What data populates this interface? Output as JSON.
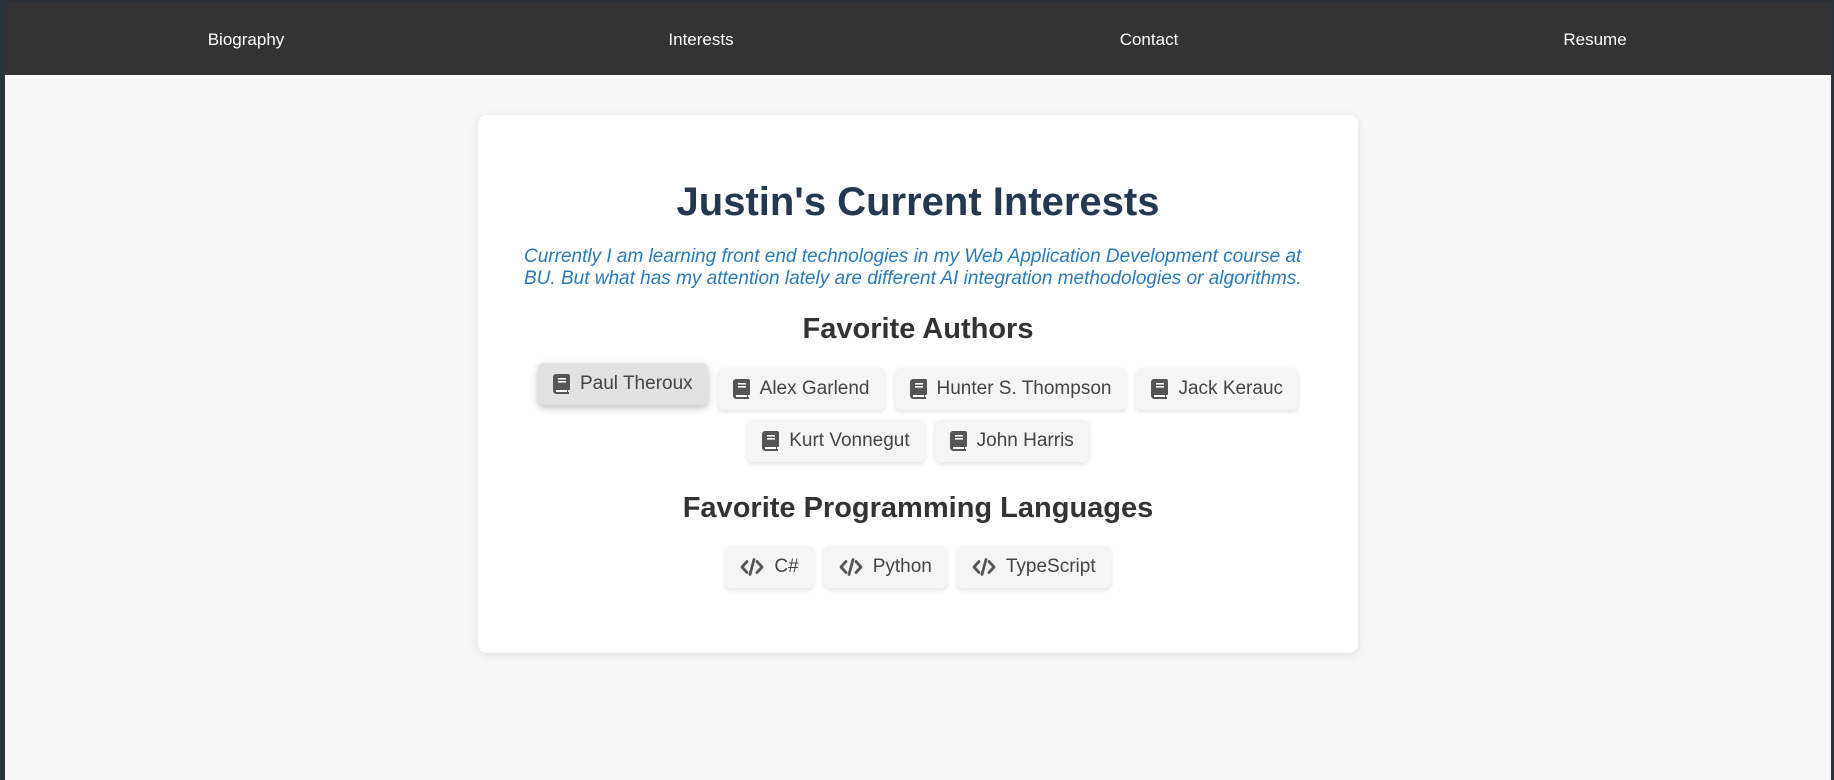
{
  "nav": {
    "items": [
      {
        "label": "Biography"
      },
      {
        "label": "Interests"
      },
      {
        "label": "Contact"
      },
      {
        "label": "Resume"
      }
    ]
  },
  "main": {
    "title": "Justin's Current Interests",
    "intro": "Currently I am learning front end technologies in my Web Application Development course at BU. But what has my attention lately are different AI integration methodologies or algorithms.",
    "authors_heading": "Favorite Authors",
    "authors": [
      {
        "label": "Paul Theroux",
        "icon": "book-icon"
      },
      {
        "label": "Alex Garlend",
        "icon": "book-icon"
      },
      {
        "label": "Hunter S. Thompson",
        "icon": "book-icon"
      },
      {
        "label": "Jack Kerauc",
        "icon": "book-icon"
      },
      {
        "label": "Kurt Vonnegut",
        "icon": "book-icon"
      },
      {
        "label": "John Harris",
        "icon": "book-icon"
      }
    ],
    "languages_heading": "Favorite Programming Languages",
    "languages": [
      {
        "label": "C#",
        "icon": "code-icon"
      },
      {
        "label": "Python",
        "icon": "code-icon"
      },
      {
        "label": "TypeScript",
        "icon": "code-icon"
      }
    ]
  },
  "colors": {
    "navbar": "#333333",
    "title": "#24384f",
    "intro": "#2a7ab8",
    "background": "#f7f7f7"
  }
}
